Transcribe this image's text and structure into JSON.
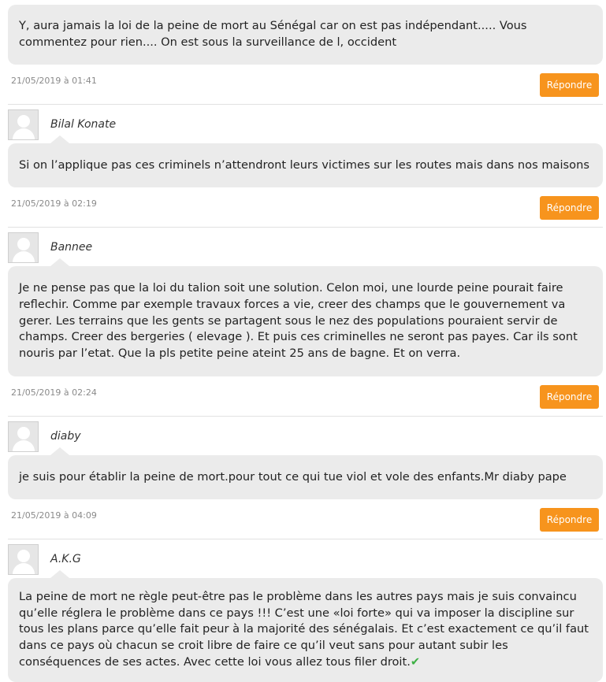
{
  "reply_label": "Répondre",
  "check_glyph": "✔",
  "comments": [
    {
      "author": "",
      "text": "Y, aura jamais la loi de la peine de mort au Sénégal car on est pas indépendant..... Vous commentez pour rien.... On est sous la surveillance de l, occident",
      "date": "21/05/2019 à 01:41"
    },
    {
      "author": "Bilal Konate",
      "text": "Si on l’applique pas ces criminels n’attendront leurs victimes sur les routes mais dans nos maisons",
      "date": "21/05/2019 à 02:19"
    },
    {
      "author": "Bannee",
      "text": "Je ne pense pas que la loi du talion soit une solution. Celon moi, une lourde peine pourait faire reflechir. Comme par exemple travaux forces a vie, creer des champs que le gouvernement va gerer. Les terrains que les gents se partagent sous le nez des populations pouraient servir de champs. Creer des bergeries ( elevage ). Et puis ces criminelles ne seront pas payes. Car ils sont nouris par l’etat. Que la pls petite peine ateint 25 ans de bagne. Et on verra.",
      "date": "21/05/2019 à 02:24"
    },
    {
      "author": "diaby",
      "text": "je suis pour établir la peine de mort.pour tout ce qui tue viol et vole des enfants.Mr diaby pape",
      "date": "21/05/2019 à 04:09"
    },
    {
      "author": "A.K.G",
      "text": "La peine de mort ne règle peut-être pas le problème dans les autres pays mais je suis convaincu qu’elle réglera le problème dans ce pays !!! C’est une «loi forte» qui va imposer la discipline sur tous les plans parce qu’elle fait peur à la majorité des sénégalais. Et c’est exactement ce qu’il faut dans ce pays où chacun se croit libre de faire ce qu’il veut sans pour autant subir les conséquences de ses actes. Avec cette loi vous allez tous filer droit.",
      "date": ""
    }
  ]
}
